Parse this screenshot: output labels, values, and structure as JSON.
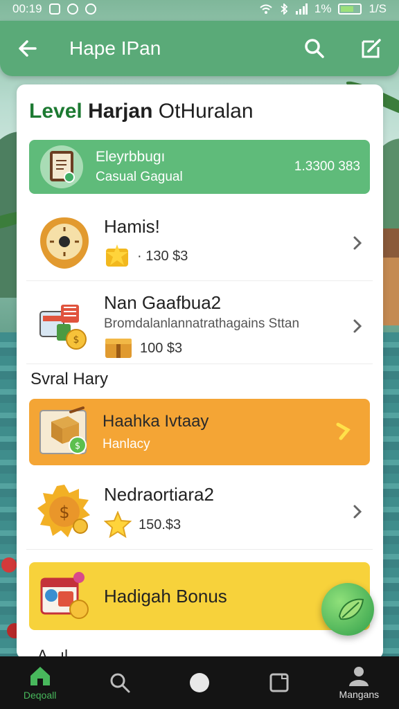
{
  "status_bar": {
    "time": "00:19",
    "battery_text": "1/S",
    "signal_text": "1%"
  },
  "app_bar": {
    "title": "Hape IPan"
  },
  "card": {
    "title_level": "Level",
    "title_name": "Harjan",
    "title_rest": "OtHuralan",
    "featured": {
      "line1": "Eleyrbbugı",
      "line2": "Casual Gagual",
      "value": "1.3300 383"
    },
    "items": [
      {
        "name": "Hamis!",
        "price": "· 130 $3"
      },
      {
        "name": "Nan Gaafbua2",
        "subtitle": "Bromdalanlannatrathagains Sttan",
        "price": "100 $3"
      }
    ],
    "section_label": "Svral Hary",
    "orange_item": {
      "name": "Haahka Ivtaay",
      "subtitle": "Hanlacy"
    },
    "item3": {
      "name": "Nedraortiara2",
      "price": "150.$3"
    },
    "bonus": {
      "name": "Hadigah Bonus"
    },
    "partial_text": "A...ıl"
  },
  "bottom_nav": [
    {
      "label": "Deqoall",
      "icon": "home-icon",
      "active": true
    },
    {
      "label": "",
      "icon": "search-icon",
      "active": false
    },
    {
      "label": "",
      "icon": "circle-icon",
      "active": false
    },
    {
      "label": "",
      "icon": "square-icon",
      "active": false
    },
    {
      "label": "Mangans",
      "icon": "profile-icon",
      "active": false
    }
  ],
  "colors": {
    "app_bar": "#5aaa78",
    "featured": "#5fbb7a",
    "orange": "#f4a535",
    "yellow": "#f7d23b",
    "accent_green": "#1d7a32"
  }
}
